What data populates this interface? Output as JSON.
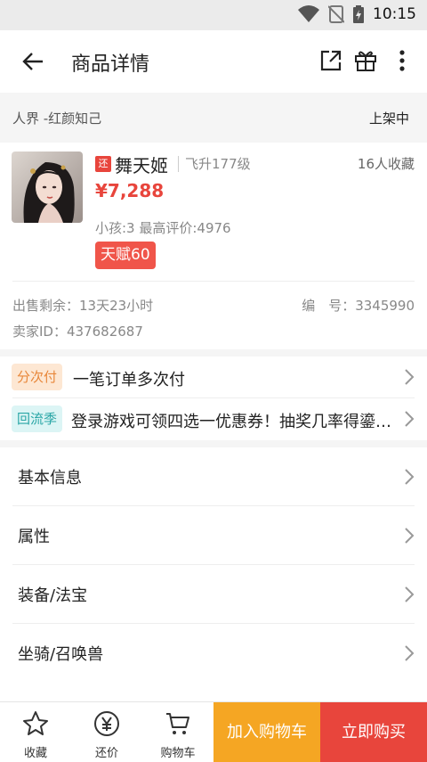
{
  "status_bar": {
    "time": "10:15"
  },
  "app_bar": {
    "title": "商品详情"
  },
  "seller_bar": {
    "server": "人界 -红颜知己",
    "status": "上架中"
  },
  "product": {
    "return_tag": "还",
    "name": "舞天姬",
    "level": "飞升177级",
    "favorites": "16人收藏",
    "price": "¥7,288",
    "meta": "小孩:3 最高评价:4976",
    "talent": "天赋60",
    "sale_remaining": "出售剩余：13天23小时",
    "sale_number": "编　号：3345990",
    "seller_id": "卖家ID：437682687"
  },
  "promos": [
    {
      "badge": "分次付",
      "text": "一笔订单多次付",
      "badge_bg": "#fde7d3",
      "badge_color": "#e8873a"
    },
    {
      "badge": "回流季",
      "text": "登录游戏可领四选一优惠券！抽奖几率得鎏金宝鉴",
      "badge_bg": "#dcf5f5",
      "badge_color": "#2aa6a6"
    }
  ],
  "sections": [
    {
      "label": "基本信息"
    },
    {
      "label": "属性"
    },
    {
      "label": "装备/法宝"
    },
    {
      "label": "坐骑/召唤兽"
    }
  ],
  "bottom_bar": {
    "favorite_label": "收藏",
    "bargain_label": "还价",
    "cart_label": "购物车",
    "add_cart_button": "加入购物车",
    "buy_button": "立即购买"
  },
  "colors": {
    "accent_red": "#e8453c",
    "accent_orange": "#f5a623"
  }
}
